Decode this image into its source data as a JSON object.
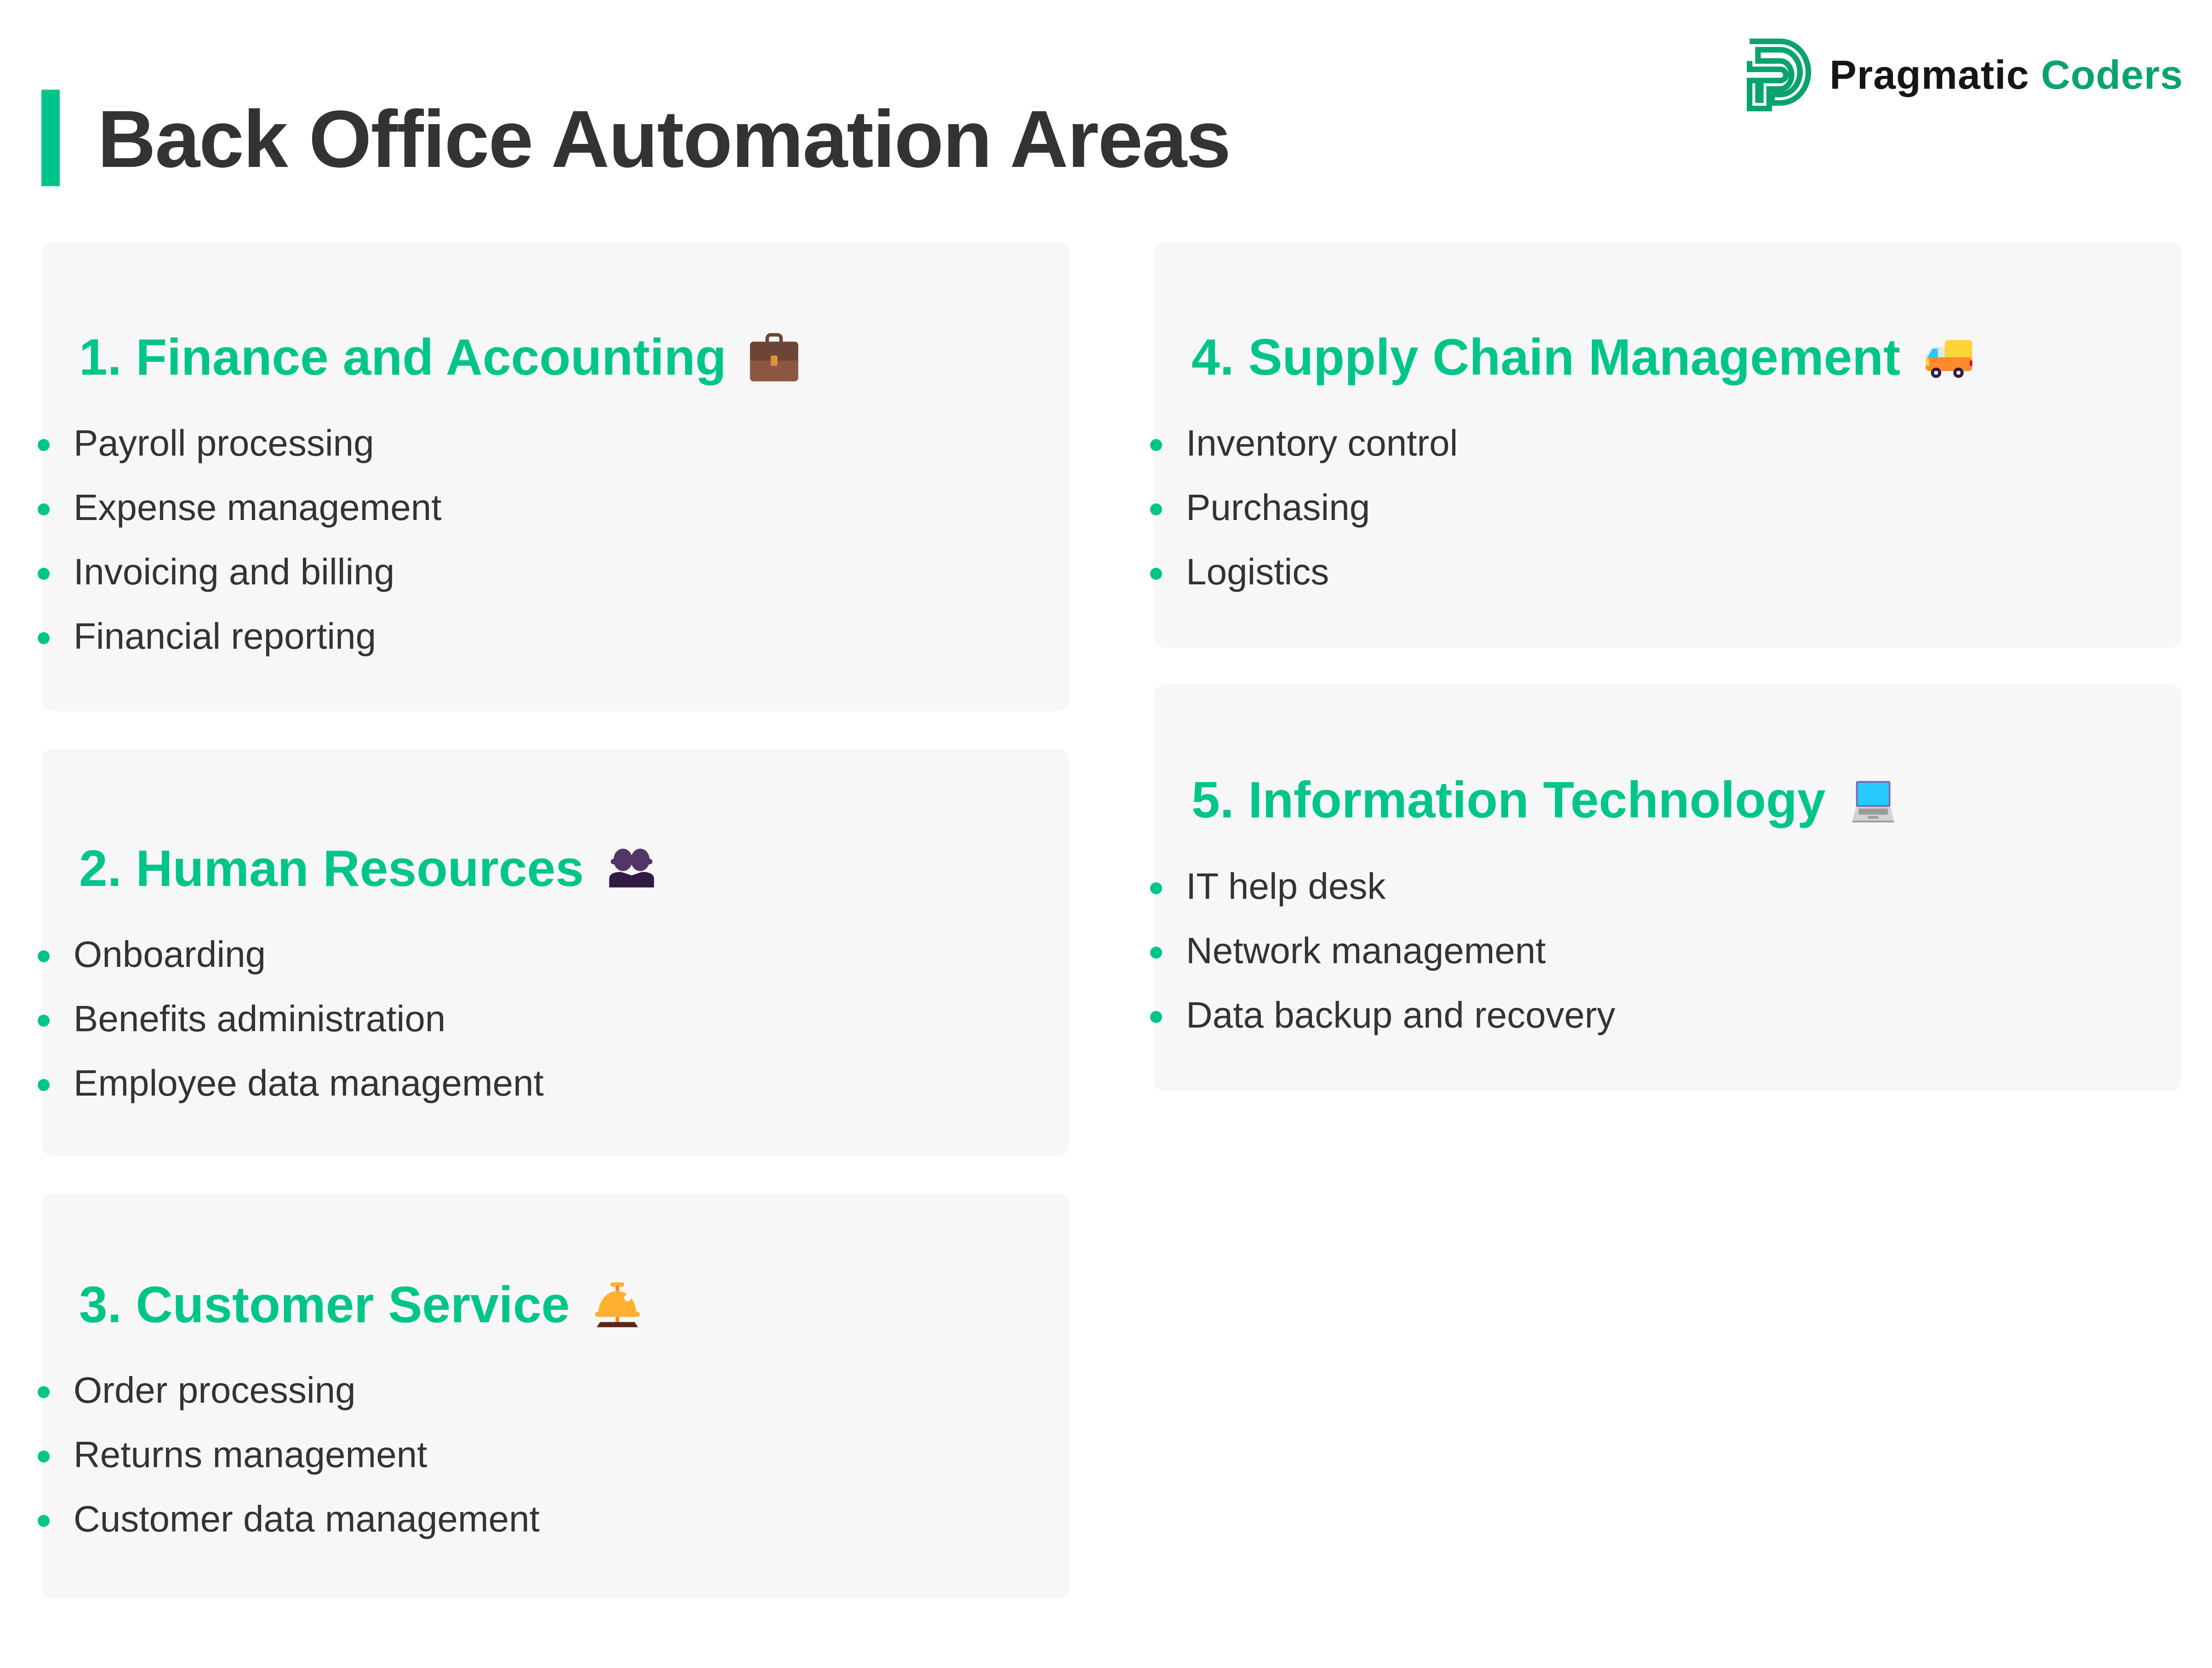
{
  "header": {
    "title": "Back Office Automation Areas",
    "accent_color": "#00c58a"
  },
  "logo": {
    "word1": "Pragmatic",
    "word2": "Coders",
    "icon": "pragmatic-coders-logo-icon",
    "brand_color": "#0aa36e"
  },
  "sections": [
    {
      "heading": "1. Finance and Accounting",
      "icon": "briefcase-icon",
      "items": [
        "Payroll processing",
        "Expense management",
        "Invoicing and billing",
        "Financial reporting"
      ]
    },
    {
      "heading": "2. Human Resources",
      "icon": "people-icon",
      "items": [
        "Onboarding",
        "Benefits administration",
        "Employee data management"
      ]
    },
    {
      "heading": "3. Customer Service",
      "icon": "bellhop-bell-icon",
      "items": [
        "Order processing",
        "Returns management",
        "Customer data management"
      ]
    },
    {
      "heading": "4. Supply Chain Management",
      "icon": "delivery-truck-icon",
      "items": [
        "Inventory control",
        "Purchasing",
        "Logistics"
      ]
    },
    {
      "heading": "5. Information Technology",
      "icon": "laptop-icon",
      "items": [
        "IT help desk",
        "Network management",
        "Data backup and recovery"
      ]
    }
  ]
}
